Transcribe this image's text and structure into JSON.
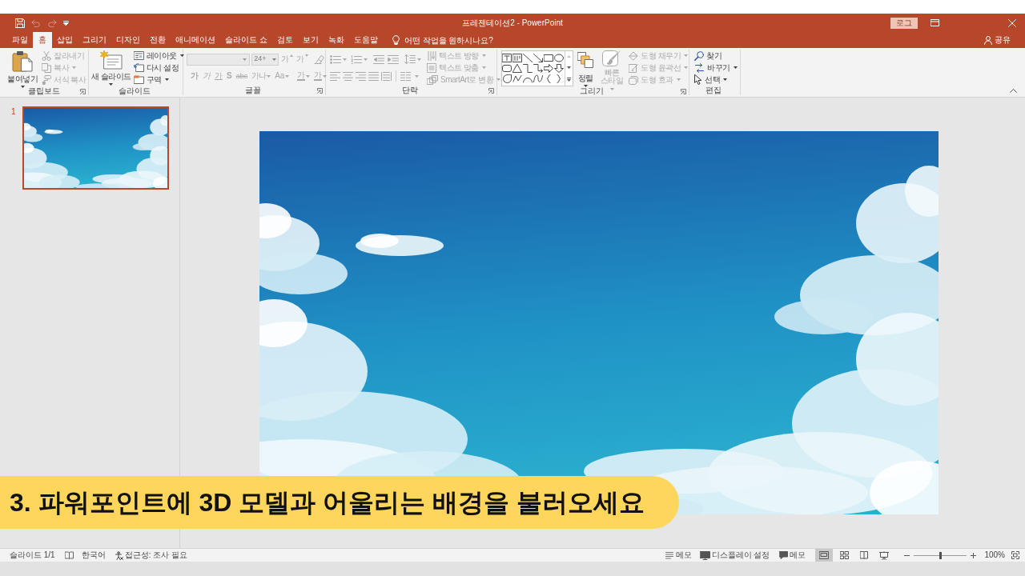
{
  "window": {
    "title": "프레젠테이션2 - PowerPoint",
    "sign_in": "로그",
    "share": "공유"
  },
  "quick_access": [
    {
      "kind": "save",
      "disabled": false
    },
    {
      "kind": "undo",
      "disabled": true
    },
    {
      "kind": "redo",
      "disabled": true
    },
    {
      "kind": "customize",
      "disabled": false
    }
  ],
  "tabs": [
    {
      "label": "파일",
      "selected": false
    },
    {
      "label": "홈",
      "selected": true
    },
    {
      "label": "삽입",
      "selected": false
    },
    {
      "label": "그리기",
      "selected": false
    },
    {
      "label": "디자인",
      "selected": false
    },
    {
      "label": "전환",
      "selected": false
    },
    {
      "label": "애니메이션",
      "selected": false
    },
    {
      "label": "슬라이드 쇼",
      "selected": false
    },
    {
      "label": "검토",
      "selected": false
    },
    {
      "label": "보기",
      "selected": false
    },
    {
      "label": "녹화",
      "selected": false
    },
    {
      "label": "도움말",
      "selected": false
    }
  ],
  "tell_me": {
    "placeholder": "어떤 작업을 원하시나요?"
  },
  "ribbon": {
    "clipboard": {
      "label": "클립보드",
      "items": [
        {
          "label": "붙여넣기",
          "disabled": false
        },
        {
          "label": "잘라내기",
          "disabled": true
        },
        {
          "label": "복사",
          "disabled": true
        },
        {
          "label": "서식 복사",
          "disabled": true
        }
      ]
    },
    "slides": {
      "label": "슬라이드",
      "items": [
        {
          "label": "새 슬라이드",
          "disabled": false
        },
        {
          "label": "레이아웃",
          "disabled": false
        },
        {
          "label": "다시 설정",
          "disabled": false
        },
        {
          "label": "구역",
          "disabled": false
        }
      ]
    },
    "font": {
      "label": "글꼴",
      "disabled": true,
      "font_size": "24+",
      "buttons": [
        "가",
        "가",
        "가",
        "가",
        "가",
        "S",
        "abc",
        "가나",
        "Aa",
        "가",
        "가"
      ]
    },
    "paragraph": {
      "label": "단락",
      "disabled": true,
      "items": [
        "텍스트 방향",
        "텍스트 맞춤",
        "SmartArt로 변환"
      ]
    },
    "drawing": {
      "label": "그리기",
      "items": [
        {
          "label": "정렬",
          "disabled": false
        },
        {
          "label": "빠른 스타일",
          "disabled": true
        },
        {
          "label": "도형 채우기",
          "disabled": true
        },
        {
          "label": "도형 윤곽선",
          "disabled": true
        },
        {
          "label": "도형 효과",
          "disabled": true
        }
      ]
    },
    "editing": {
      "label": "편집",
      "items": [
        {
          "label": "찾기",
          "disabled": false
        },
        {
          "label": "바꾸기",
          "disabled": false
        },
        {
          "label": "선택",
          "disabled": false
        }
      ]
    }
  },
  "slides": [
    {
      "number": "1",
      "selected": true
    }
  ],
  "caption": "3. 파워포인트에 3D 모델과 어울리는 배경을 불러오세요",
  "status_bar": {
    "slide_info": "슬라이드 1/1",
    "language": "한국어",
    "accessibility": "접근성: 조사 필요",
    "notes": "메모",
    "display_settings": "디스플레이 설정",
    "comments": "메모",
    "views": [
      {
        "kind": "normal",
        "selected": true
      },
      {
        "kind": "sorter",
        "selected": false
      },
      {
        "kind": "reading",
        "selected": false
      },
      {
        "kind": "slideshow",
        "selected": false
      }
    ],
    "zoom": {
      "level": 0.5,
      "reading": "100%"
    }
  }
}
